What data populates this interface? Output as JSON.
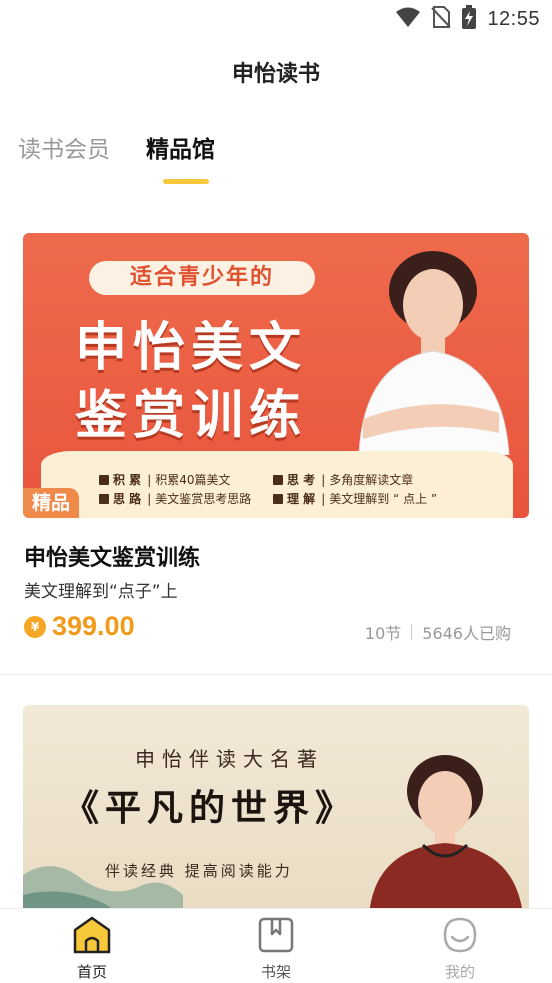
{
  "status_bar": {
    "time": "12:55"
  },
  "header": {
    "title": "申怡读书"
  },
  "tabs": [
    {
      "label": "读书会员",
      "active": false
    },
    {
      "label": "精品馆",
      "active": true
    }
  ],
  "courses": [
    {
      "banner": {
        "pill": "适合青少年的",
        "title_line1": "申怡美文",
        "title_line2": "鉴赏训练",
        "features": [
          {
            "key": "积 累",
            "text": "积累40篇美文"
          },
          {
            "key": "思 考",
            "text": "多角度解读文章"
          },
          {
            "key": "思 路",
            "text": "美文鉴赏思考思路"
          },
          {
            "key": "理 解",
            "text": "美文理解到 “ 点上 ”"
          }
        ],
        "badge": "精品"
      },
      "title": "申怡美文鉴赏训练",
      "subtitle": "美文理解到“点子”上",
      "currency_symbol": "¥",
      "price": "399.00",
      "lessons": "10节",
      "purchases": "5646人已购"
    },
    {
      "banner": {
        "top": "申怡伴读大名著",
        "title": "《平凡的世界》",
        "sub": "伴读经典  提高阅读能力"
      }
    }
  ],
  "bottom_nav": [
    {
      "label": "首页",
      "icon": "home-icon",
      "active": true
    },
    {
      "label": "书架",
      "icon": "bookshelf-icon",
      "active": false
    },
    {
      "label": "我的",
      "icon": "profile-icon",
      "active": false
    }
  ],
  "colors": {
    "accent": "#f7c83a",
    "price": "#f29a1a",
    "banner1_bg": "#e8553c",
    "badge": "#f08a4b"
  }
}
